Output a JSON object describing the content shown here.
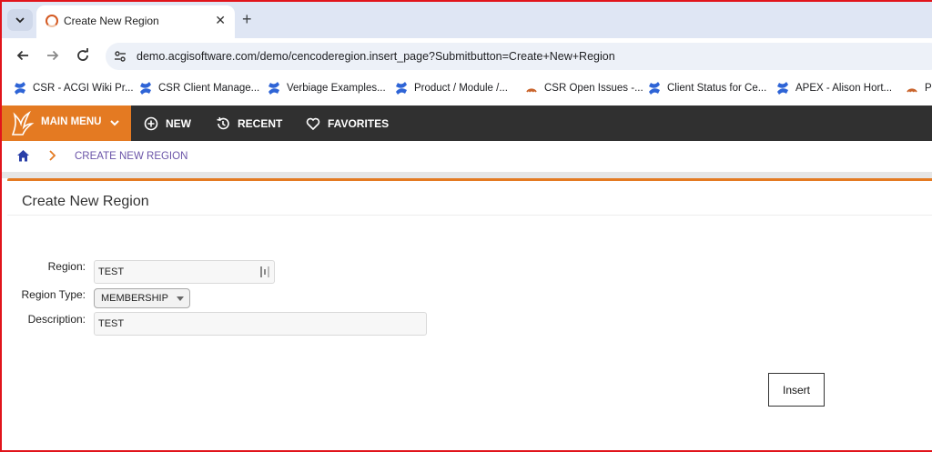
{
  "browser": {
    "tab_title": "Create New Region",
    "new_tab_symbol": "+",
    "close_symbol": "✕",
    "url": "demo.acgisoftware.com/demo/cencoderegion.insert_page?Submitbutton=Create+New+Region",
    "bookmarks": [
      {
        "label": "CSR - ACGI Wiki Pr...",
        "icon": "confluence-icon"
      },
      {
        "label": "CSR Client Manage...",
        "icon": "confluence-icon"
      },
      {
        "label": "Verbiage Examples...",
        "icon": "confluence-icon"
      },
      {
        "label": "Product / Module /...",
        "icon": "confluence-icon"
      },
      {
        "label": "CSR Open Issues -...",
        "icon": "apex-icon"
      },
      {
        "label": "Client Status for Ce...",
        "icon": "confluence-icon"
      },
      {
        "label": "APEX - Alison Hort...",
        "icon": "confluence-icon"
      },
      {
        "label": "Pe",
        "icon": "apex-icon"
      }
    ]
  },
  "appbar": {
    "main_menu": "MAIN MENU",
    "new": "NEW",
    "recent": "RECENT",
    "favorites": "FAVORITES",
    "accent": "#e47a22",
    "background": "#303030"
  },
  "breadcrumb": {
    "current": "CREATE NEW REGION"
  },
  "form": {
    "title": "Create New Region",
    "region_label": "Region:",
    "region_value": "TEST",
    "region_type_label": "Region Type:",
    "region_type_value": "MEMBERSHIP",
    "description_label": "Description:",
    "description_value": "TEST",
    "insert_button": "Insert"
  }
}
